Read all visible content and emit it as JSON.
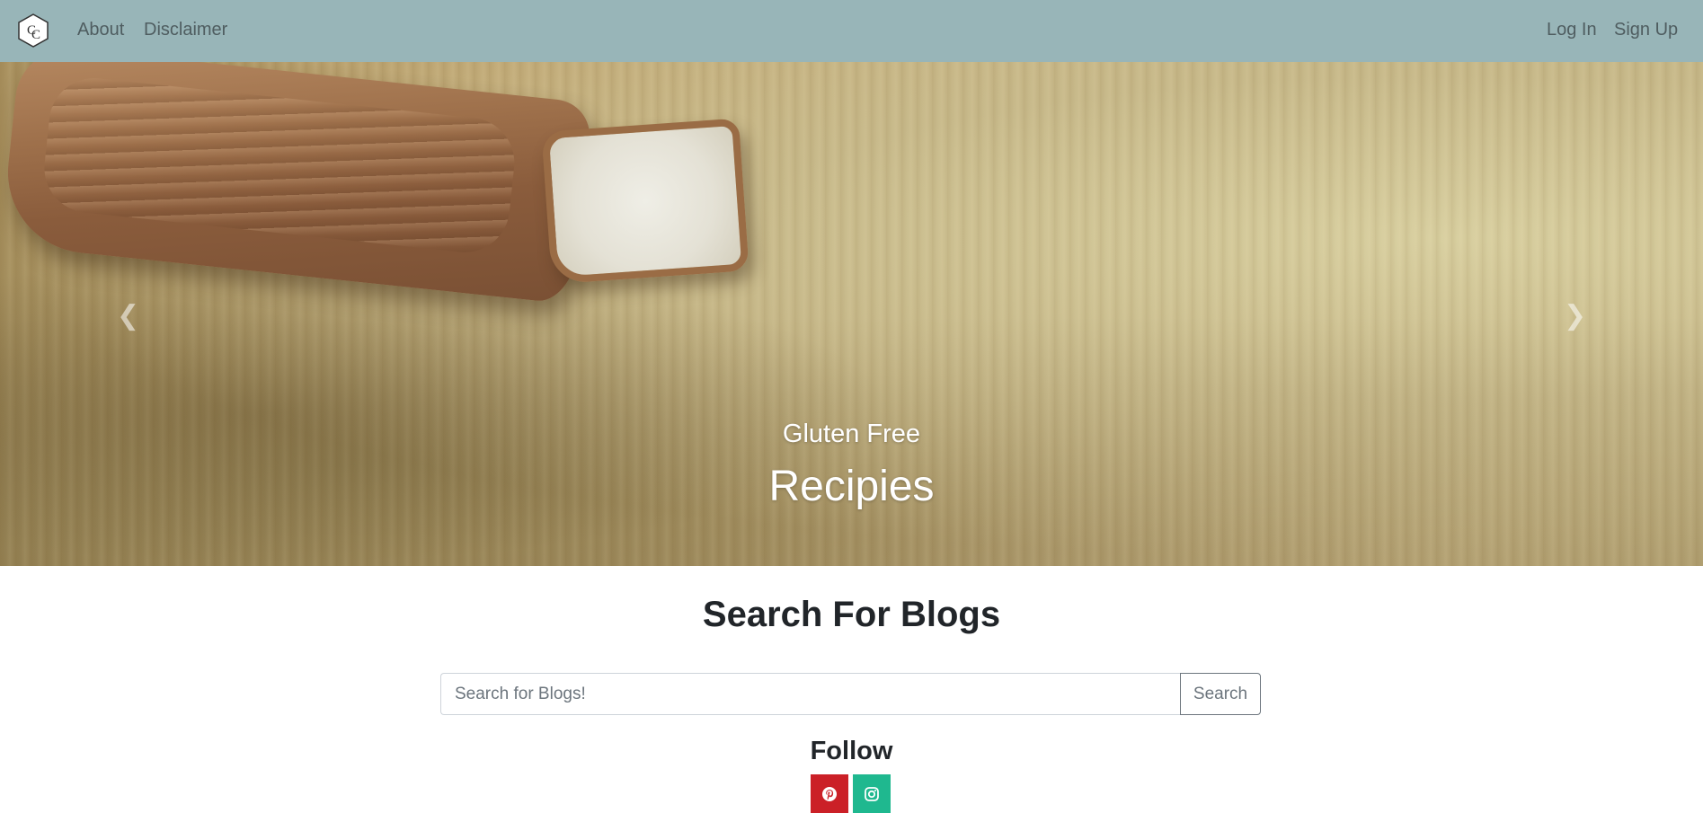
{
  "navbar": {
    "logo_icon": "cc-hexagon-logo-icon",
    "links_left": [
      "About",
      "Disclaimer"
    ],
    "links_right": [
      "Log In",
      "Sign Up"
    ],
    "background": "#98b5b8"
  },
  "hero": {
    "subtitle": "Gluten Free",
    "title": "Recipies",
    "prev_icon": "chevron-left-icon",
    "next_icon": "chevron-right-icon"
  },
  "search": {
    "heading": "Search For Blogs",
    "placeholder": "Search for Blogs!",
    "value": "",
    "button_label": "Search"
  },
  "follow": {
    "heading": "Follow",
    "links": [
      {
        "icon": "pinterest-icon",
        "color": "#cb2027"
      },
      {
        "icon": "instagram-icon",
        "color": "#1fb88f"
      }
    ]
  }
}
